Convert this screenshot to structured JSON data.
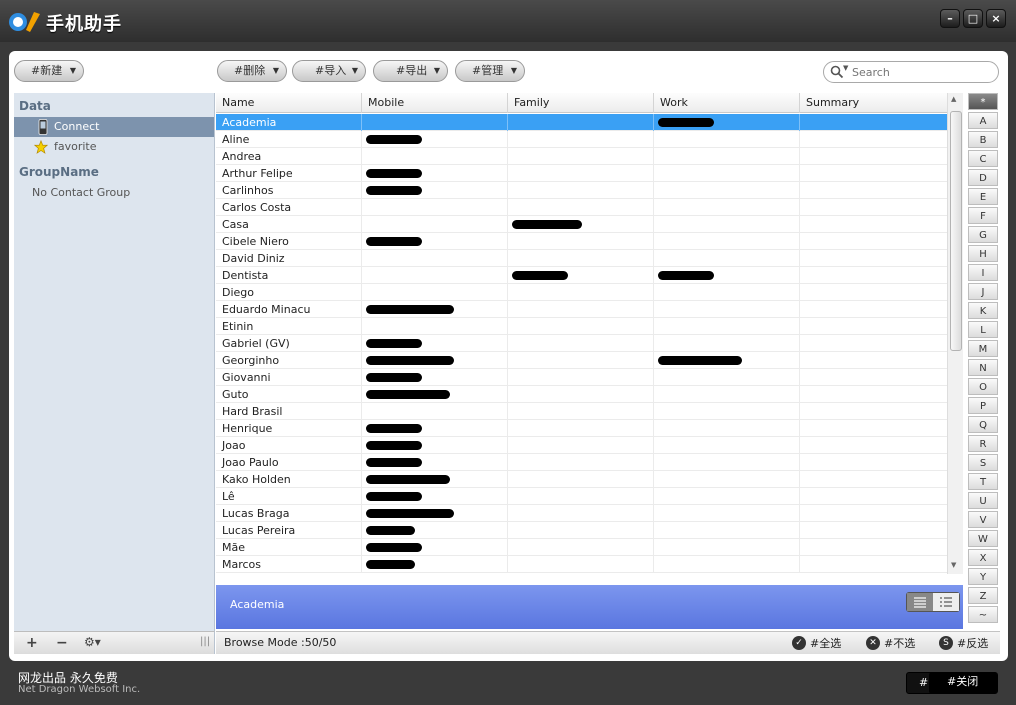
{
  "app": {
    "title": "手机助手"
  },
  "window": {
    "minimize": "–",
    "maximize": "□",
    "close": "×"
  },
  "toolbar": {
    "new_label": "#新建",
    "delete_label": "#删除",
    "import_label": "#导入",
    "export_label": "#导出",
    "manage_label": "#管理"
  },
  "search": {
    "placeholder": "Search"
  },
  "sidebar": {
    "data_heading": "Data",
    "items": [
      {
        "label": "Connect",
        "icon": "phone-icon",
        "selected": true
      },
      {
        "label": "favorite",
        "icon": "star-icon",
        "selected": false
      }
    ],
    "group_heading": "GroupName",
    "groups": [
      {
        "label": "No Contact Group"
      }
    ]
  },
  "table": {
    "columns": [
      "Name",
      "Mobile",
      "Family",
      "Work",
      "Summary"
    ],
    "rows": [
      {
        "name": "Academia",
        "mobile": "",
        "family": "",
        "work": "2357XXXX",
        "selected": true
      },
      {
        "name": "Aline",
        "mobile": "7725XXXX"
      },
      {
        "name": "Andrea",
        "mobile": ""
      },
      {
        "name": "Arthur Felipe",
        "mobile": "XXXXXXXX"
      },
      {
        "name": "Carlinhos",
        "mobile": "XXXXXXXX"
      },
      {
        "name": "Carlos Costa",
        "mobile": ""
      },
      {
        "name": "Casa",
        "mobile": "",
        "family": "XXXXXXXXXX"
      },
      {
        "name": "Cibele Niero",
        "mobile": "XXXXXXXX"
      },
      {
        "name": "David Diniz",
        "mobile": ""
      },
      {
        "name": "Dentista",
        "mobile": "",
        "family": "XXXXXXXX",
        "work": "XXXXXXXX"
      },
      {
        "name": "Diego",
        "mobile": ""
      },
      {
        "name": "Eduardo Minacu",
        "mobile": "XXXXXXXXXXXXX"
      },
      {
        "name": "Etinin",
        "mobile": ""
      },
      {
        "name": "Gabriel (GV)",
        "mobile": "XXXXXXXX"
      },
      {
        "name": "Georginho",
        "mobile": "XXXXXXXXXXXXXX",
        "work": "XXXXXXXXXXXX"
      },
      {
        "name": "Giovanni",
        "mobile": "XXXXXXXX"
      },
      {
        "name": "Guto",
        "mobile": "XXXXXXXXXXXX"
      },
      {
        "name": "Hard Brasil",
        "mobile": ""
      },
      {
        "name": "Henrique",
        "mobile": "XXXXXXXX"
      },
      {
        "name": "Joao",
        "mobile": "XXXXXXXX"
      },
      {
        "name": "Joao Paulo",
        "mobile": "XXXXXXXX"
      },
      {
        "name": "Kako Holden",
        "mobile": "XXXXXXXXXXXX"
      },
      {
        "name": "Lê",
        "mobile": "XXXXXXXX"
      },
      {
        "name": "Lucas Braga",
        "mobile": "XXXXXXXXXXXXX"
      },
      {
        "name": "Lucas Pereira",
        "mobile": "XXXXXXX"
      },
      {
        "name": "Mãe",
        "mobile": "XXXXXXXX"
      },
      {
        "name": "Marcos",
        "mobile": "XXXXXXX"
      }
    ]
  },
  "alphabet": [
    "*",
    "A",
    "B",
    "C",
    "D",
    "E",
    "F",
    "G",
    "H",
    "I",
    "J",
    "K",
    "L",
    "M",
    "N",
    "O",
    "P",
    "Q",
    "R",
    "S",
    "T",
    "U",
    "V",
    "W",
    "X",
    "Y",
    "Z",
    "~"
  ],
  "detail": {
    "name": "Academia"
  },
  "status": {
    "browse_mode": "Browse Mode :50/50",
    "select_all": "#全选",
    "select_none": "#不选",
    "invert": "#反选"
  },
  "footer": {
    "brand_cn": "网龙出品 永久免费",
    "brand_en": "Net Dragon Websoft Inc.",
    "close_label": "#关闭",
    "close_prefix": "#"
  }
}
